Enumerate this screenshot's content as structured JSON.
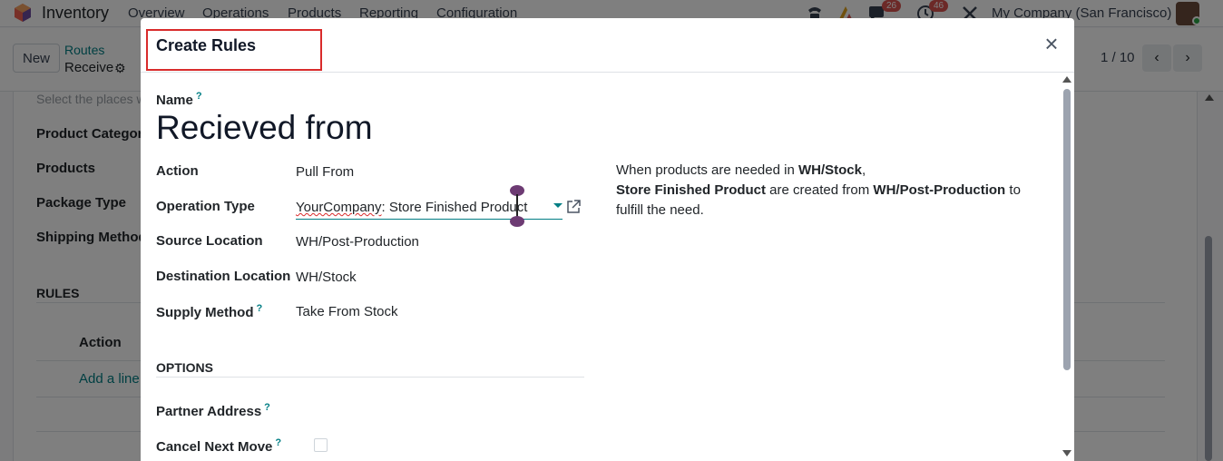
{
  "app": {
    "name": "Inventory",
    "menu": [
      "Overview",
      "Operations",
      "Products",
      "Reporting",
      "Configuration"
    ],
    "badges": {
      "messages": "26",
      "activities": "46"
    },
    "company": "My Company (San Francisco)"
  },
  "control": {
    "new_label": "New",
    "breadcrumb_parent": "Routes",
    "breadcrumb_current": "Receive",
    "pager": "1 / 10"
  },
  "sheet": {
    "muted_text": "Select the places w",
    "fields": [
      "Product Categorie",
      "Products",
      "Package Type",
      "Shipping Method"
    ],
    "rules_title": "RULES",
    "rules_col_action": "Action",
    "add_line": "Add a line"
  },
  "modal": {
    "title": "Create Rules",
    "name_label": "Name",
    "name_value": "Recieved from",
    "fields": {
      "action": {
        "label": "Action",
        "value": "Pull From"
      },
      "operation_type": {
        "label": "Operation Type",
        "value_prefix": "YourCompany",
        "value_suffix": ": Store Finished Product"
      },
      "source_location": {
        "label": "Source Location",
        "value": "WH/Post-Production"
      },
      "destination_location": {
        "label": "Destination Location",
        "value": "WH/Stock"
      },
      "supply_method": {
        "label": "Supply Method",
        "value": "Take From Stock"
      }
    },
    "options_title": "OPTIONS",
    "partner_address_label": "Partner Address",
    "cancel_next_move_label": "Cancel Next Move",
    "help": {
      "p1": "When products are needed in ",
      "b1": "WH/Stock",
      "p2": ",",
      "b2": "Store Finished Product",
      "p3": " are created from ",
      "b3": "WH/Post-Production",
      "p4": " to fulfill the need."
    },
    "help_mark": "?"
  },
  "colors": {
    "accent": "#017e84",
    "highlight": "#d92b2b"
  }
}
